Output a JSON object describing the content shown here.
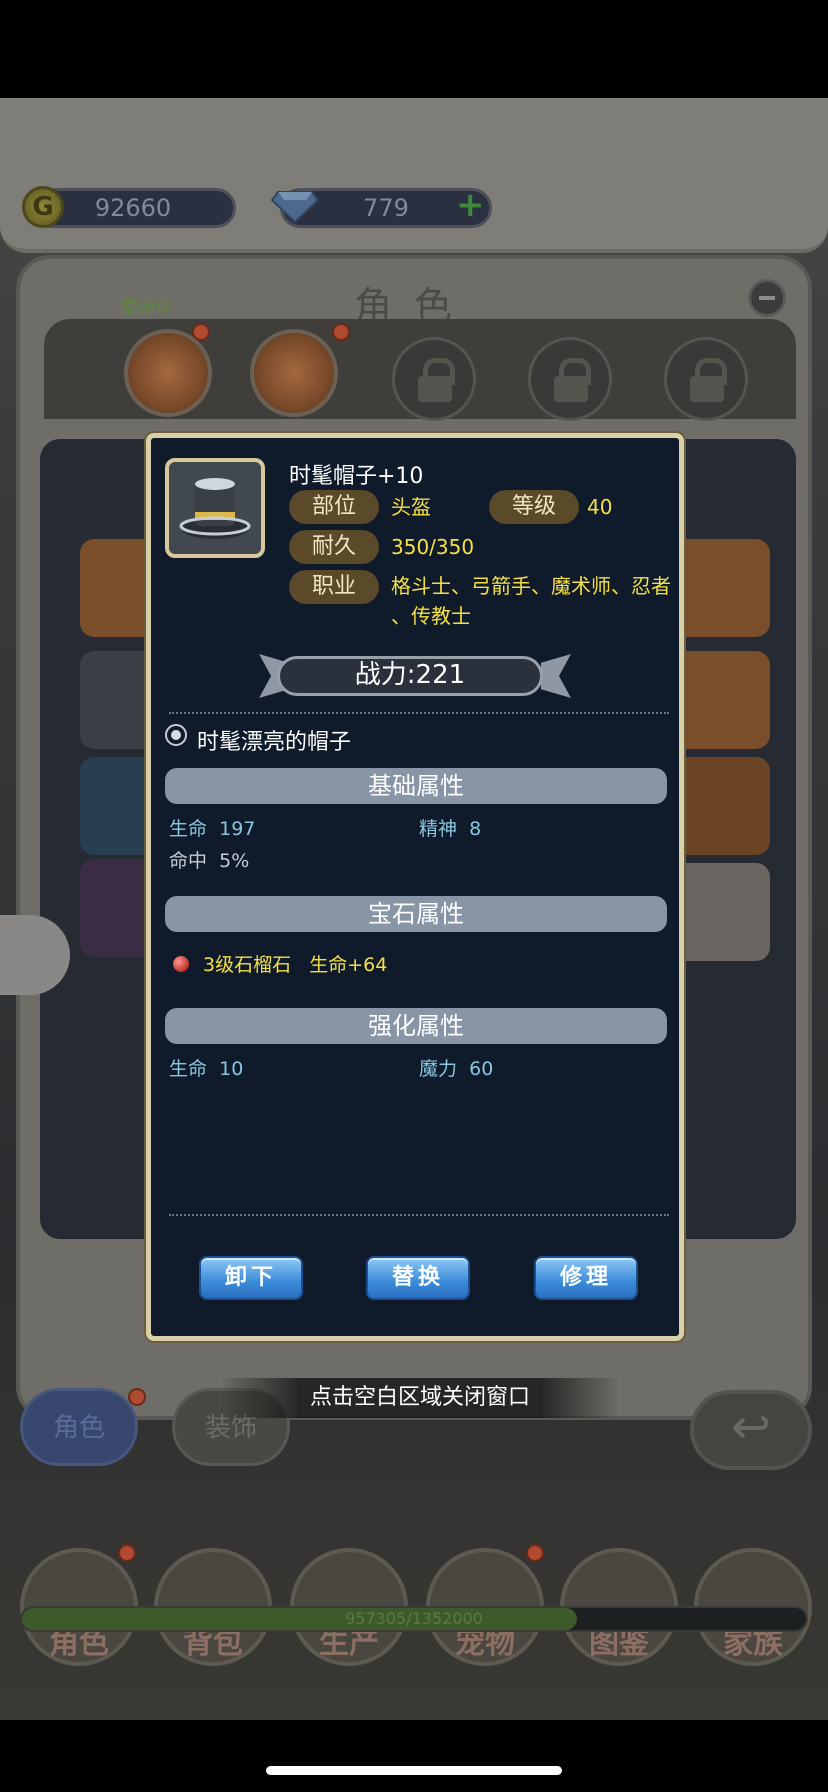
{
  "currency": {
    "gold": "92660",
    "diamonds": "779",
    "gold_icon": "gold-coin-icon",
    "diamond_icon": "diamond-icon"
  },
  "character_panel": {
    "title": "角色",
    "in_use_label": "使用中"
  },
  "bottom_tabs": {
    "character": "角色",
    "decor": "装饰"
  },
  "close_hint": "点击空白区域关闭窗口",
  "nav": [
    {
      "label": "角色",
      "icon": "character-icon"
    },
    {
      "label": "背包",
      "icon": "backpack-icon"
    },
    {
      "label": "生产",
      "icon": "production-icon"
    },
    {
      "label": "宠物",
      "icon": "pet-icon"
    },
    {
      "label": "图鉴",
      "icon": "codex-icon"
    },
    {
      "label": "家族",
      "icon": "family-icon"
    }
  ],
  "exp_bar": {
    "text": "957305/1352000",
    "fraction": 0.708
  },
  "item": {
    "name": "时髦帽子+10",
    "slot_label": "部位",
    "slot_value": "头盔",
    "level_label": "等级",
    "level_value": "40",
    "durability_label": "耐久",
    "durability_value": "350/350",
    "class_label": "职业",
    "class_value_line1": "格斗士、弓箭手、魔术师、忍者",
    "class_value_line2": "、传教士",
    "power": "战力:221",
    "description": "时髦漂亮的帽子",
    "base_header": "基础属性",
    "base_stats": [
      {
        "name": "生命",
        "value": "197"
      },
      {
        "name": "精神",
        "value": "8"
      },
      {
        "name": "命中",
        "value": "5%"
      }
    ],
    "gem_header": "宝石属性",
    "gem_name": "3级石榴石",
    "gem_effect": "生命+64",
    "enhance_header": "强化属性",
    "enhance_stats": [
      {
        "name": "生命",
        "value": "10"
      },
      {
        "name": "魔力",
        "value": "60"
      }
    ],
    "buttons": {
      "unequip": "卸下",
      "replace": "替换",
      "repair": "修理"
    }
  },
  "colors": {
    "popup_bg": "#0f1a2b",
    "yellow_text": "#f4e046",
    "cyan_text": "#8ac7df",
    "button_blue": "#3b8bd9"
  }
}
